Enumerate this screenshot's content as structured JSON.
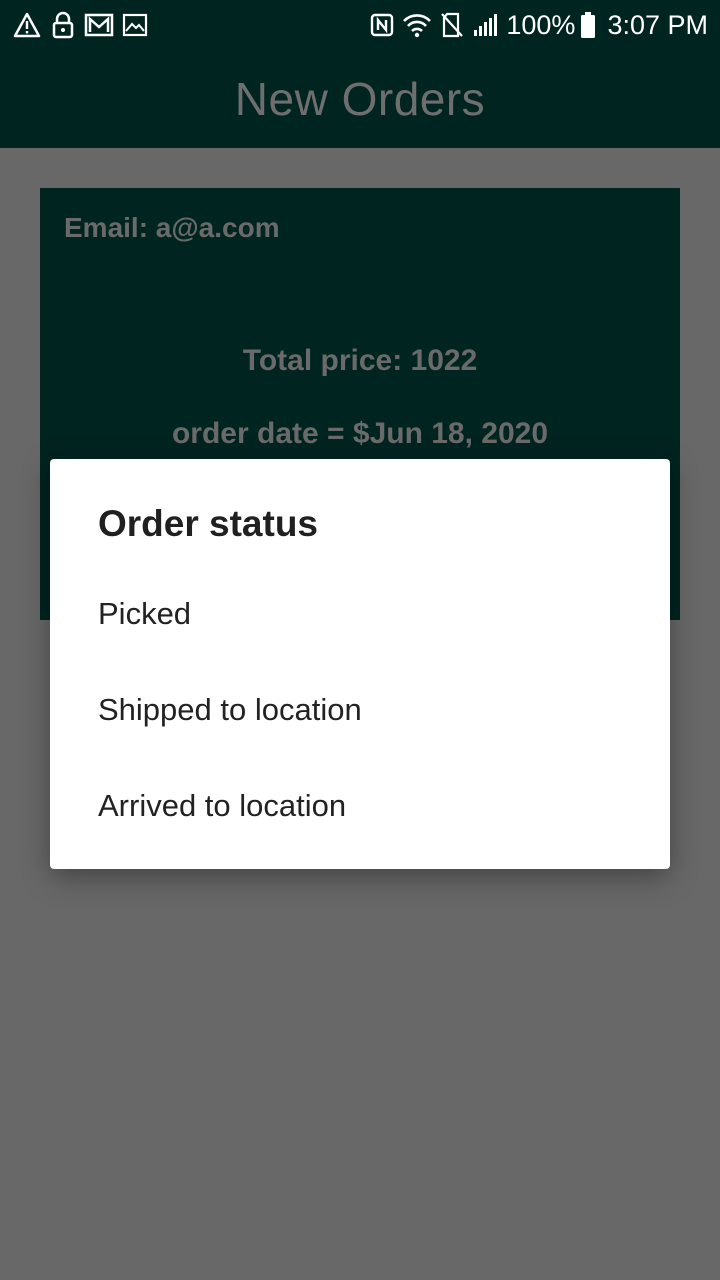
{
  "status_bar": {
    "left_icons": [
      "warning-icon",
      "lock-icon",
      "gmail-icon",
      "image-icon"
    ],
    "right_icons": [
      "nfc-icon",
      "wifi-icon",
      "no-sim-icon",
      "signal-icon"
    ],
    "battery": "100%",
    "time": "3:07 PM"
  },
  "app_bar": {
    "title": "New Orders"
  },
  "order": {
    "email": "Email: a@a.com",
    "total": "Total price: 1022",
    "date": "order date =  $Jun 18, 2020"
  },
  "dialog": {
    "title": "Order status",
    "options": [
      "Picked",
      "Shipped to location",
      "Arrived to location"
    ]
  },
  "colors": {
    "primary_dark": "#002420",
    "scrim_background": "#686868",
    "dialog_background": "#ffffff"
  }
}
